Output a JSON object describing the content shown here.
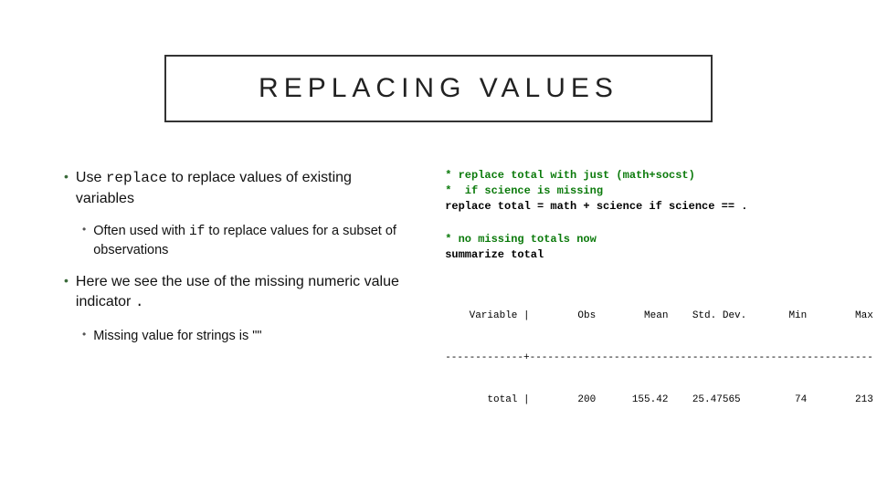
{
  "title": "REPLACING VALUES",
  "bullets": {
    "b1a_pre": "Use ",
    "b1a_code": "replace",
    "b1a_post": " to replace values of existing variables",
    "b2a_pre": "Often used with ",
    "b2a_code": "if",
    "b2a_post": " to replace values for a subset of observations",
    "b1b_pre": "Here we see the use of the missing numeric value indicator ",
    "b1b_code": ".",
    "b2b": "Missing value for strings is \"\""
  },
  "code1": {
    "c1": "* replace total with just (math+socst)",
    "c2": "*  if science is missing",
    "l1": "replace total = math + science if science == ."
  },
  "code2": {
    "c1": "* no missing totals now",
    "l1": "summarize total"
  },
  "table": {
    "header": "    Variable |        Obs        Mean    Std. Dev.       Min        Max",
    "sep": "-------------+---------------------------------------------------------",
    "row": "       total |        200      155.42    25.47565         74        213"
  },
  "chart_data": {
    "type": "table",
    "title": "summarize total",
    "columns": [
      "Variable",
      "Obs",
      "Mean",
      "Std. Dev.",
      "Min",
      "Max"
    ],
    "rows": [
      {
        "Variable": "total",
        "Obs": 200,
        "Mean": 155.42,
        "Std. Dev.": 25.47565,
        "Min": 74,
        "Max": 213
      }
    ]
  }
}
